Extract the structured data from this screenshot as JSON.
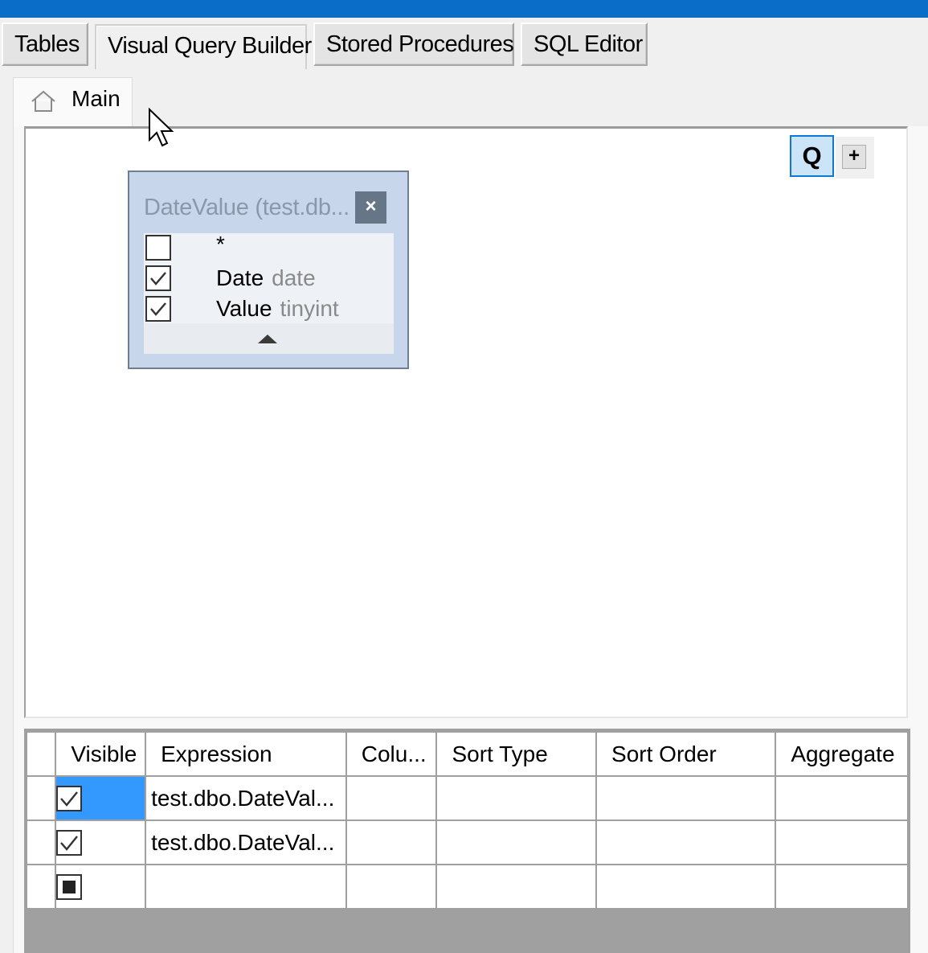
{
  "top_tabs": [
    {
      "label": "Tables",
      "active": false
    },
    {
      "label": "Visual Query Builder",
      "active": true
    },
    {
      "label": "Stored Procedures",
      "active": false
    },
    {
      "label": "SQL Editor",
      "active": false
    }
  ],
  "query_tab": {
    "label": "Main",
    "icon": "home-icon"
  },
  "canvas_buttons": {
    "query": "Q",
    "add": "+"
  },
  "table_box": {
    "title": "DateValue (test.db...",
    "close": "×",
    "fields": [
      {
        "name": "*",
        "type": "",
        "checked": false
      },
      {
        "name": "Date",
        "type": "date",
        "checked": true
      },
      {
        "name": "Value",
        "type": "tinyint",
        "checked": true
      }
    ]
  },
  "grid": {
    "columns": [
      "Visible",
      "Expression",
      "Colu...",
      "Sort Type",
      "Sort Order",
      "Aggregate"
    ],
    "rows": [
      {
        "visible": "checked",
        "expression": "test.dbo.DateVal...",
        "column": "",
        "sort_type": "",
        "sort_order": "",
        "aggregate": "",
        "selected": true
      },
      {
        "visible": "checked",
        "expression": "test.dbo.DateVal...",
        "column": "",
        "sort_type": "",
        "sort_order": "",
        "aggregate": "",
        "selected": false
      },
      {
        "visible": "indeterminate",
        "expression": "",
        "column": "",
        "sort_type": "",
        "sort_order": "",
        "aggregate": "",
        "selected": false
      }
    ]
  }
}
